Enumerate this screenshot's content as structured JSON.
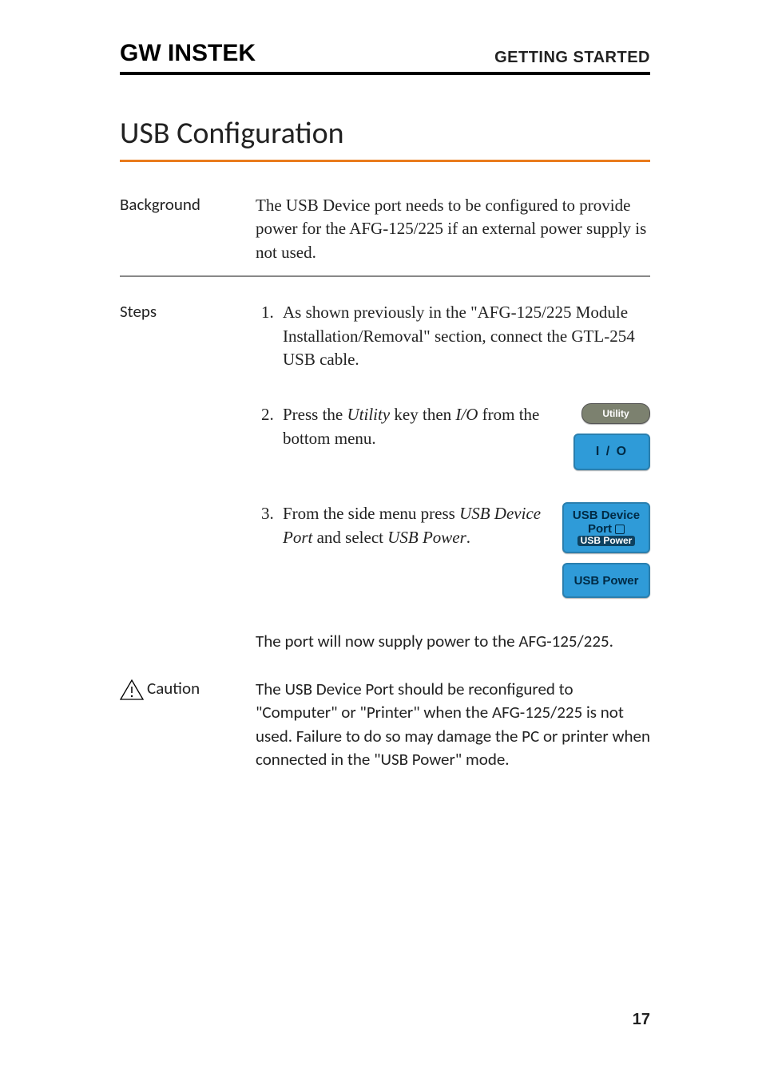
{
  "header": {
    "brand": "GW INSTEK",
    "chapter": "GETTING STARTED"
  },
  "title": "USB Configuration",
  "background": {
    "label": "Background",
    "text": "The USB Device port needs to be configured to provide power for the AFG-125/225 if an external power supply is not used."
  },
  "steps": {
    "label": "Steps",
    "items": [
      {
        "text_before": "As shown previously in the \"AFG-125/225 Module Installation/Removal\" section, connect the GTL-254 USB cable."
      },
      {
        "prefix": "Press the ",
        "em1": "Utility",
        "mid": " key then ",
        "em2": "I/O",
        "suffix": " from the bottom menu.",
        "btn1": "Utility",
        "btn2": "I / O"
      },
      {
        "prefix": "From the side menu press ",
        "em1": "USB Device Port",
        "mid": " and select ",
        "em2": "USB Power",
        "suffix": ".",
        "btn_device_l1": "USB Device",
        "btn_device_l2": "Port",
        "btn_device_pill": "USB Power",
        "btn_power": "USB Power"
      }
    ],
    "port_note": "The port will now supply power to the AFG-125/225."
  },
  "caution": {
    "label": "Caution",
    "text": "The USB Device Port should be reconfigured to \"Computer\" or \"Printer\" when the AFG-125/225 is not used. Failure to do so may damage the PC or printer when connected in the \"USB Power\" mode."
  },
  "page_number": "17"
}
